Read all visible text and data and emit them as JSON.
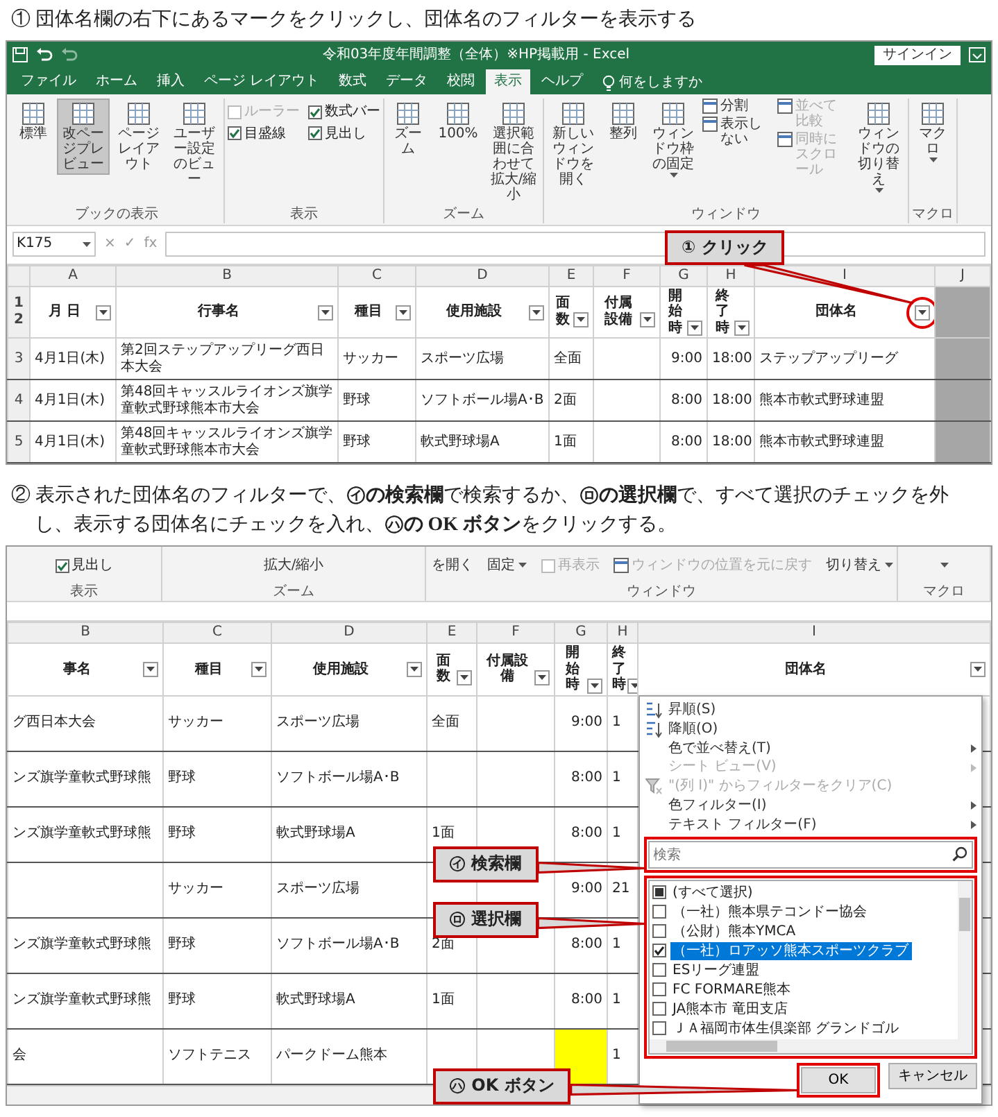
{
  "step1": {
    "text": "① 団体名欄の右下にあるマークをクリックし、団体名のフィルターを表示する"
  },
  "excel1": {
    "title": "令和03年度年間調整（全体）※HP掲載用 - Excel",
    "sign_in": "サインイン",
    "tabs": [
      {
        "label": "ファイル",
        "selected": false
      },
      {
        "label": "ホーム",
        "selected": false
      },
      {
        "label": "挿入",
        "selected": false
      },
      {
        "label": "ページ レイアウト",
        "selected": false
      },
      {
        "label": "数式",
        "selected": false
      },
      {
        "label": "データ",
        "selected": false
      },
      {
        "label": "校閲",
        "selected": false
      },
      {
        "label": "表示",
        "selected": true
      },
      {
        "label": "ヘルプ",
        "selected": false
      }
    ],
    "tell_me": "何をしますか",
    "ribbon_groups": [
      {
        "label": "ブックの表示",
        "items": [
          {
            "kind": "large",
            "label": "標準",
            "selected": false
          },
          {
            "kind": "large",
            "label": "改ページプレビュー",
            "selected": true
          },
          {
            "kind": "large",
            "label": "ページレイアウト",
            "selected": false
          },
          {
            "kind": "large",
            "label": "ユーザー設定のビュー",
            "selected": false
          }
        ]
      },
      {
        "label": "表示",
        "items": [
          {
            "kind": "checks",
            "items": [
              {
                "label": "ルーラー",
                "checked": false,
                "disabled": true
              },
              {
                "label": "数式バー",
                "checked": true,
                "disabled": false
              },
              {
                "label": "目盛線",
                "checked": true,
                "disabled": false
              },
              {
                "label": "見出し",
                "checked": true,
                "disabled": false
              }
            ]
          }
        ]
      },
      {
        "label": "ズーム",
        "items": [
          {
            "kind": "large",
            "label": "ズーム",
            "selected": false
          },
          {
            "kind": "large",
            "label": "100%",
            "selected": false
          },
          {
            "kind": "large",
            "label": "選択範囲に合わせて拡大/縮小",
            "selected": false
          }
        ]
      },
      {
        "label": "ウィンドウ",
        "items": [
          {
            "kind": "large",
            "label": "新しいウィンドウを開く",
            "selected": false
          },
          {
            "kind": "large",
            "label": "整列",
            "selected": false
          },
          {
            "kind": "large",
            "label": "ウィンドウ枠の固定",
            "selected": false,
            "dropdown": true
          },
          {
            "kind": "stack",
            "items": [
              {
                "label": "分割",
                "disabled": false
              },
              {
                "label": "表示しない",
                "disabled": false
              }
            ]
          },
          {
            "kind": "stack",
            "items": [
              {
                "label": "並べて比較",
                "disabled": true
              },
              {
                "label": "同時にスクロール",
                "disabled": true
              }
            ]
          },
          {
            "kind": "large",
            "label": "ウィンドウの切り替え",
            "selected": false,
            "dropdown": true
          }
        ]
      },
      {
        "label": "マクロ",
        "items": [
          {
            "kind": "large",
            "label": "マクロ",
            "selected": false,
            "dropdown": true
          }
        ]
      }
    ],
    "formula_bar": {
      "name_box": "K175",
      "buttons": [
        "×",
        "✓",
        "fx"
      ]
    },
    "callout": {
      "text": "① クリック"
    },
    "column_letters": [
      "A",
      "B",
      "C",
      "D",
      "E",
      "F",
      "G",
      "H",
      "I",
      "J"
    ],
    "header_row_numbers": [
      "1",
      "2"
    ],
    "headers": [
      {
        "label": "月 日",
        "circled": false
      },
      {
        "label": "行事名",
        "circled": false
      },
      {
        "label": "種目",
        "circled": false
      },
      {
        "label": "使用施設",
        "circled": false
      },
      {
        "label": "面数",
        "circled": false
      },
      {
        "label": "付属設備",
        "circled": false
      },
      {
        "label": "開始時",
        "circled": false
      },
      {
        "label": "終了時",
        "circled": false
      },
      {
        "label": "団体名",
        "circled": true
      }
    ],
    "rows": [
      {
        "number": "3",
        "cells": [
          "4月1日(木)",
          "第2回ステップアップリーグ西日本大会",
          "サッカー",
          "スポーツ広場",
          "全面",
          null,
          "9:00",
          "18:00",
          "ステップアップリーグ"
        ]
      },
      {
        "number": "4",
        "cells": [
          "4月1日(木)",
          "第48回キャッスルライオンズ旗学童軟式野球熊本市大会",
          "野球",
          "ソフトボール場A･B",
          "2面",
          null,
          "8:00",
          "18:00",
          "熊本市軟式野球連盟"
        ]
      },
      {
        "number": "5",
        "cells": [
          "4月1日(木)",
          "第48回キャッスルライオンズ旗学童軟式野球熊本市大会",
          "野球",
          "軟式野球場A",
          "1面",
          null,
          "8:00",
          "18:00",
          "熊本市軟式野球連盟"
        ]
      }
    ]
  },
  "step2": {
    "text": "② 表示された団体名のフィルターで、**㋑の検索欄**で検索するか、**㋺の選択欄**で、すべて選択のチェックを外し、表示する団体名にチェックを入れ、**㋩の OK ボタン**をクリックする。"
  },
  "excel2": {
    "ribbon_groups": [
      {
        "label": "表示",
        "items": [
          {
            "kind": "check",
            "label": "見出し",
            "checked": true,
            "disabled": false
          }
        ]
      },
      {
        "label": "ズーム",
        "items": [
          {
            "kind": "text",
            "label": "拡大/縮小"
          }
        ]
      },
      {
        "label": "ウィンドウ",
        "items": [
          {
            "kind": "text",
            "label": "を開く"
          },
          {
            "kind": "text",
            "label": "固定",
            "dropdown": true
          },
          {
            "kind": "check",
            "label": "再表示",
            "checked": false,
            "disabled": true
          },
          {
            "kind": "small",
            "label": "ウィンドウの位置を元に戻す",
            "disabled": true
          },
          {
            "kind": "text",
            "label": "切り替え",
            "dropdown": true
          }
        ]
      },
      {
        "label": "マクロ",
        "items": [
          {
            "kind": "caret"
          }
        ]
      }
    ],
    "column_letters": [
      "B",
      "C",
      "D",
      "E",
      "F",
      "G",
      "H",
      "I"
    ],
    "headers": [
      {
        "label": "事名",
        "circled": false
      },
      {
        "label": "種目",
        "circled": false
      },
      {
        "label": "使用施設",
        "circled": false
      },
      {
        "label": "面数",
        "circled": false
      },
      {
        "label": "付属設備",
        "circled": false
      },
      {
        "label": "開始時",
        "circled": false
      },
      {
        "label": "終了時",
        "circled": false
      },
      {
        "label": "団体名",
        "circled": false
      }
    ],
    "rows": [
      {
        "cells": [
          "グ西日本大会",
          "サッカー",
          "スポーツ広場",
          "全面",
          null,
          "9:00",
          "1",
          null
        ],
        "start_highlighted": false
      },
      {
        "cells": [
          "ンズ旗学童軟式野球熊",
          "野球",
          "ソフトボール場A･B",
          null,
          null,
          "8:00",
          "1",
          null
        ],
        "start_highlighted": false
      },
      {
        "cells": [
          "ンズ旗学童軟式野球熊",
          "野球",
          "軟式野球場A",
          "1面",
          null,
          "8:00",
          "1",
          null
        ],
        "start_highlighted": false
      },
      {
        "cells": [
          null,
          "サッカー",
          "スポーツ広場",
          null,
          null,
          "9:00",
          "21",
          null
        ],
        "start_highlighted": false
      },
      {
        "cells": [
          "ンズ旗学童軟式野球熊",
          "野球",
          "ソフトボール場A･B",
          "2面",
          null,
          "8:00",
          "1",
          null
        ],
        "start_highlighted": false
      },
      {
        "cells": [
          "ンズ旗学童軟式野球熊",
          "野球",
          "軟式野球場A",
          "1面",
          null,
          "8:00",
          "1",
          null
        ],
        "start_highlighted": false
      },
      {
        "cells": [
          "会",
          "ソフトテニス",
          "パークドーム熊本",
          null,
          null,
          null,
          "1",
          null
        ],
        "start_highlighted": true
      }
    ],
    "filter_panel": {
      "menu": [
        {
          "kind": "sort-asc",
          "label": "昇順(S)",
          "disabled": false,
          "submenu": false
        },
        {
          "kind": "sort-desc",
          "label": "降順(O)",
          "disabled": false,
          "submenu": false
        },
        {
          "kind": "plain",
          "label": "色で並べ替え(T)",
          "disabled": false,
          "submenu": true
        },
        {
          "kind": "plain",
          "label": "シート ビュー(V)",
          "disabled": true,
          "submenu": true
        },
        {
          "kind": "clear",
          "label": "\"(列 I)\" からフィルターをクリア(C)",
          "disabled": true,
          "submenu": false
        },
        {
          "kind": "plain",
          "label": "色フィルター(I)",
          "disabled": false,
          "submenu": true
        },
        {
          "kind": "plain",
          "label": "テキスト フィルター(F)",
          "disabled": false,
          "submenu": true
        }
      ],
      "search": {
        "placeholder": "検索",
        "highlighted": true
      },
      "list": {
        "highlighted": true,
        "items": [
          {
            "label": "(すべて選択)",
            "checked": false,
            "partial": true,
            "selected": false
          },
          {
            "label": "（一社）熊本県テコンドー協会",
            "checked": false,
            "partial": false,
            "selected": false
          },
          {
            "label": "（公財）熊本YMCA",
            "checked": false,
            "partial": false,
            "selected": false
          },
          {
            "label": "（一社）ロアッソ熊本スポーツクラブ",
            "checked": true,
            "partial": false,
            "selected": true
          },
          {
            "label": "ESリーグ連盟",
            "checked": false,
            "partial": false,
            "selected": false
          },
          {
            "label": "FC FORMARE熊本",
            "checked": false,
            "partial": false,
            "selected": false
          },
          {
            "label": "JA熊本市 竜田支店",
            "checked": false,
            "partial": false,
            "selected": false
          },
          {
            "label": "ＪＡ福岡市体生倶楽部 グランドゴル",
            "checked": false,
            "partial": false,
            "selected": false
          }
        ]
      },
      "buttons": [
        {
          "label": "OK",
          "highlighted": true
        },
        {
          "label": "キャンセル",
          "highlighted": false
        }
      ]
    },
    "callouts": [
      {
        "kind": "search",
        "text": "㋑ 検索欄"
      },
      {
        "kind": "list",
        "text": "㋺ 選択欄"
      },
      {
        "kind": "ok",
        "text": "㋩ OK ボタン"
      }
    ]
  }
}
